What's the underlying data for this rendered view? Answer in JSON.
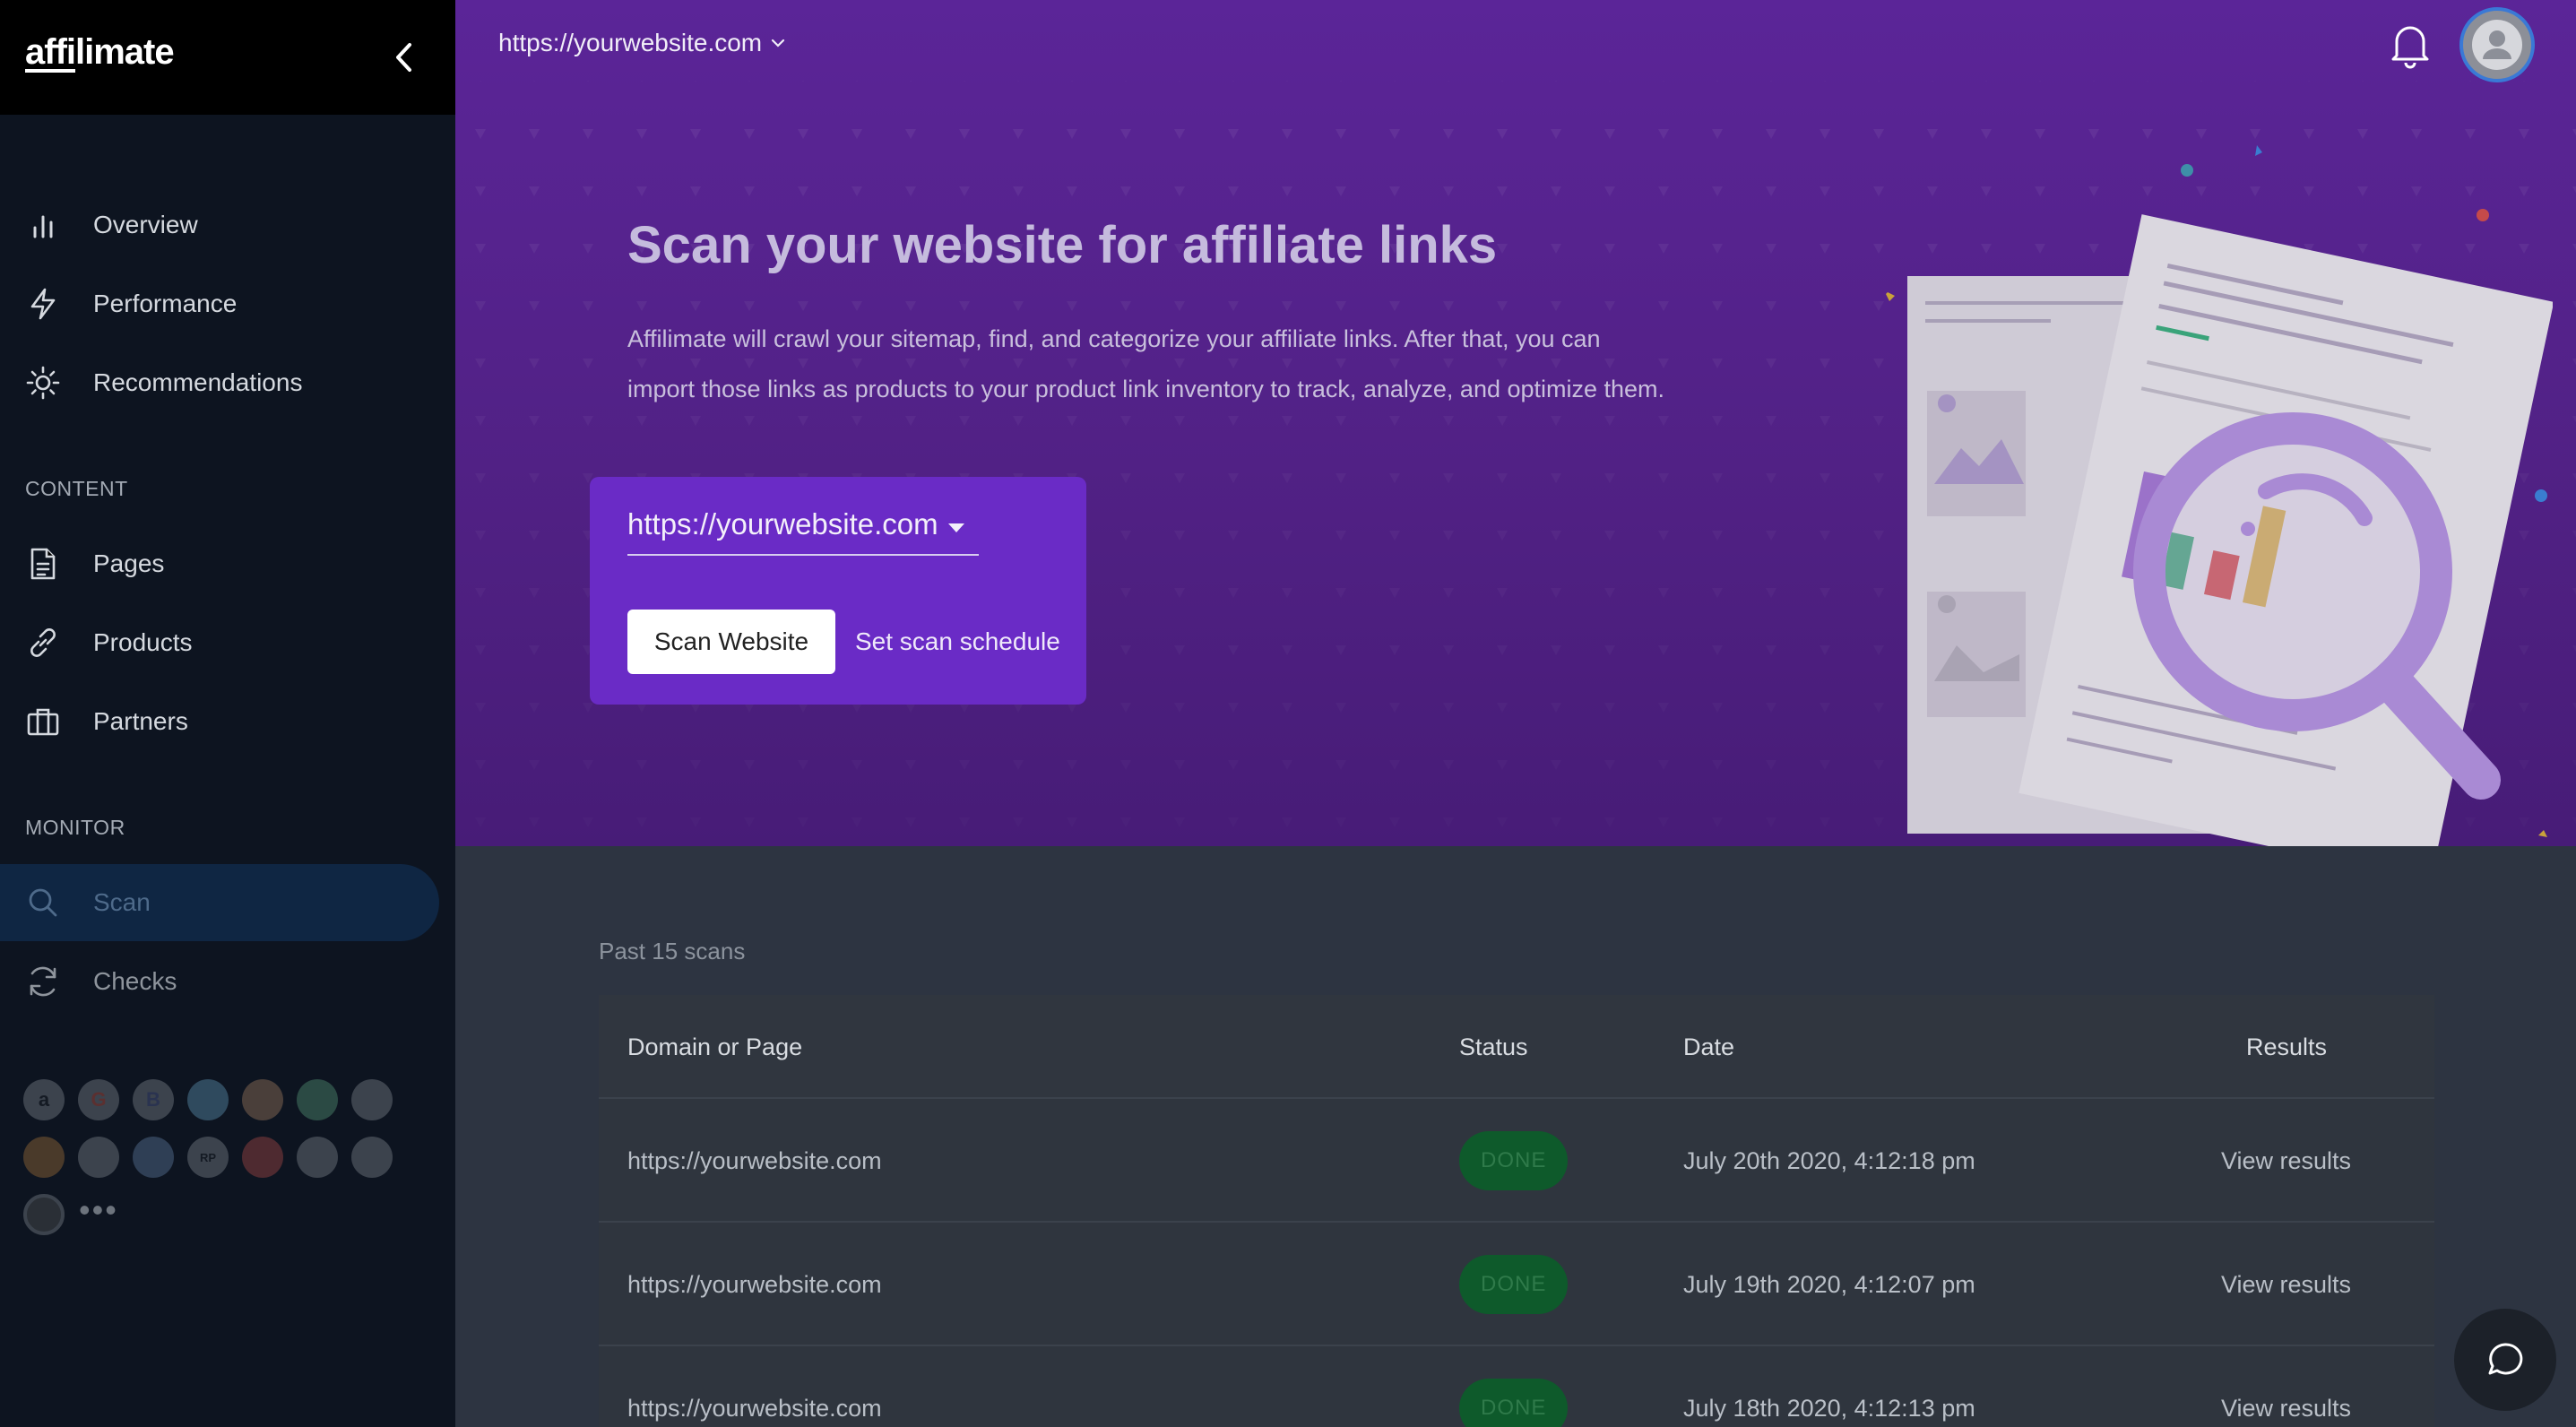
{
  "app": {
    "logo_prefix": "affi",
    "logo_suffix": "limate"
  },
  "sidebar": {
    "items": [
      {
        "label": "Overview",
        "icon": "bar-chart-icon"
      },
      {
        "label": "Performance",
        "icon": "lightning-icon"
      },
      {
        "label": "Recommendations",
        "icon": "sun-icon"
      }
    ],
    "content_section": "CONTENT",
    "content_items": [
      {
        "label": "Pages",
        "icon": "document-icon"
      },
      {
        "label": "Products",
        "icon": "link-icon"
      },
      {
        "label": "Partners",
        "icon": "briefcase-icon"
      }
    ],
    "monitor_section": "MONITOR",
    "monitor_items": [
      {
        "label": "Scan",
        "icon": "search-icon",
        "active": true
      },
      {
        "label": "Checks",
        "icon": "refresh-icon"
      }
    ],
    "partner_icons": [
      "a",
      "G",
      "B",
      "",
      "",
      "",
      "",
      "",
      "",
      "RP",
      "",
      "",
      "",
      ""
    ]
  },
  "topbar": {
    "site_url": "https://yourwebsite.com"
  },
  "hero": {
    "title": "Scan your website for affiliate links",
    "description": "Affilimate will crawl your sitemap, find, and categorize your affiliate links. After that, you can import those links as products to your product link inventory to track, analyze, and optimize them.",
    "site_select_value": "https://yourwebsite.com",
    "scan_button": "Scan Website",
    "schedule_button": "Set scan schedule"
  },
  "scans": {
    "label": "Past 15 scans",
    "columns": [
      "Domain or Page",
      "Status",
      "Date",
      "Results"
    ],
    "rows": [
      {
        "domain": "https://yourwebsite.com",
        "status": "DONE",
        "date": "July 20th 2020, 4:12:18 pm",
        "result": "View results"
      },
      {
        "domain": "https://yourwebsite.com",
        "status": "DONE",
        "date": "July 19th 2020, 4:12:07 pm",
        "result": "View results"
      },
      {
        "domain": "https://yourwebsite.com",
        "status": "DONE",
        "date": "July 18th 2020, 4:12:13 pm",
        "result": "View results"
      }
    ]
  },
  "colors": {
    "hero_purple": "#5b2598",
    "scan_box": "#6a2bc6",
    "sidebar_bg": "#0d1420",
    "badge_done": "#0e5a2b"
  }
}
